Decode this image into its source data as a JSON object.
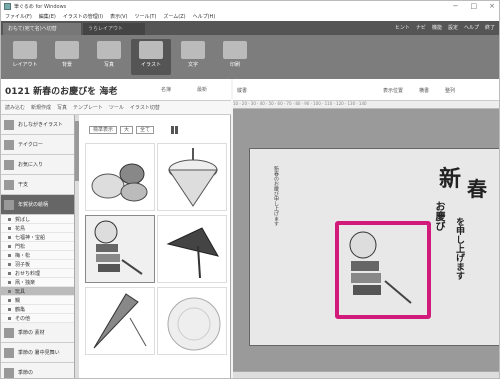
{
  "window": {
    "title": "筆ぐるめ for Windows",
    "controls": [
      "−",
      "□",
      "×"
    ]
  },
  "menu": [
    "ファイル(F)",
    "編集(E)",
    "イラストの管理(I)",
    "表示(V)",
    "ツール(T)",
    "ズーム(Z)",
    "ヘルプ(H)"
  ],
  "tabs": {
    "left": "おもて(宛て名)へ切替",
    "right": "うらレイアウト",
    "help_items": [
      "ヒント",
      "ナビ",
      "機能",
      "設定",
      "ヘルプ",
      "終了"
    ]
  },
  "ribbon": {
    "items": [
      {
        "label": "レイアウト",
        "active": false
      },
      {
        "label": "背景",
        "active": false
      },
      {
        "label": "写真",
        "active": false
      },
      {
        "label": "イラスト",
        "active": true
      },
      {
        "label": "文字",
        "active": false
      },
      {
        "label": "印刷",
        "active": false
      }
    ]
  },
  "page": {
    "title": "0121 新春のお慶びを 海老",
    "add_label": "名簿",
    "update_label": "最新"
  },
  "toolrow": [
    "読み込む",
    "新規作成",
    "写真",
    "テンプレート",
    "ツール",
    "イラスト切替"
  ],
  "sidebar": {
    "categories": [
      {
        "label": "おしながきイラスト",
        "sel": false
      },
      {
        "label": "テイクロー",
        "sel": false
      },
      {
        "label": "お気に入り",
        "sel": false
      },
      {
        "label": "干支",
        "sel": false
      },
      {
        "label": "年賀状の絵柄",
        "sel": true
      }
    ],
    "items": [
      {
        "label": "賀ばし",
        "sel": false
      },
      {
        "label": "花鳥",
        "sel": false
      },
      {
        "label": "七福神・宝船",
        "sel": false
      },
      {
        "label": "門松",
        "sel": false
      },
      {
        "label": "梅・松",
        "sel": false
      },
      {
        "label": "羽子板",
        "sel": false
      },
      {
        "label": "おせち料理",
        "sel": false
      },
      {
        "label": "凧・独楽",
        "sel": false
      },
      {
        "label": "玩具",
        "sel": true
      },
      {
        "label": "鯛",
        "sel": false
      },
      {
        "label": "鶴亀",
        "sel": false
      },
      {
        "label": "その他",
        "sel": false
      }
    ],
    "bottom": [
      {
        "label": "季節の 素材"
      },
      {
        "label": "季節の 暑中見舞い"
      },
      {
        "label": "季節の"
      }
    ]
  },
  "content": {
    "sort_label": "標準表示",
    "zoom_label": "大",
    "filter_label": "全て"
  },
  "right": {
    "header_left": "縦書",
    "header_mid": "表示位置",
    "header_r1": "横書",
    "header_r2": "整列",
    "ruler_marks": "10 · 20 · 30 · 40 · 50 · 60 · 70 · 80 · 90 · 100 · 110 · 120 · 130 · 140",
    "card_text": "新春のお慶び申し上げます",
    "callig1": "新",
    "callig2": "春",
    "callig3": "お慶び",
    "callig4": "を申し上げます"
  },
  "colors": {
    "highlight": "#d11a7a"
  }
}
